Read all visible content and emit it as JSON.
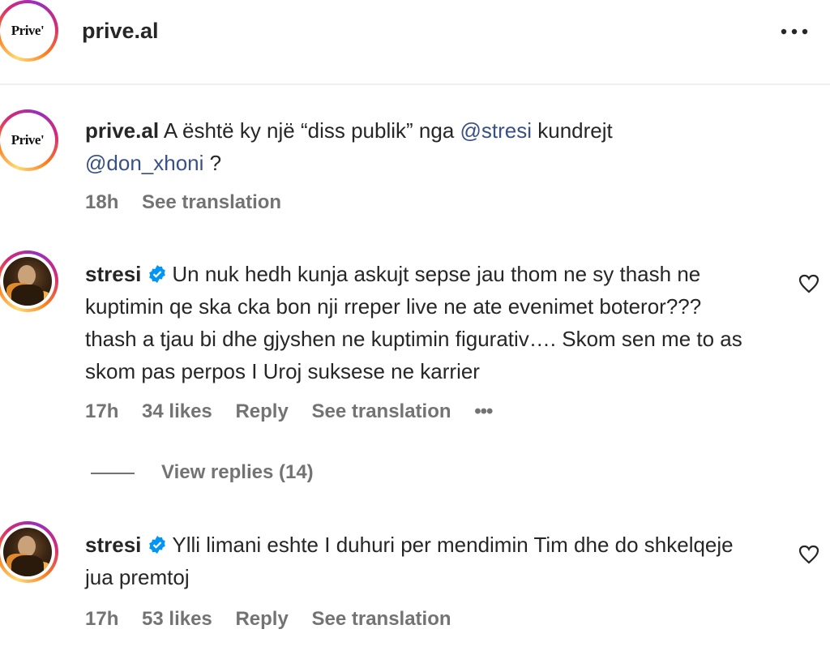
{
  "header": {
    "username": "prive.al",
    "logo_text": "Prive'",
    "more_icon": "more-horizontal-icon"
  },
  "caption": {
    "username": "prive.al",
    "text_before": "A është ky një “diss publik” nga ",
    "mention1": "@stresi",
    "text_mid": " kundrejt",
    "mention2": "@don_xhoni",
    "text_after": " ?",
    "time": "18h",
    "see_translation": "See translation"
  },
  "comments": [
    {
      "username": "stresi",
      "text": "Un nuk hedh kunja askujt sepse jau thom ne sy thash ne kuptimin qe ska cka bon nji rreper live ne ate evenimet boteror??? thash a tjau bi dhe gjyshen ne kuptimin figurativ…. Skom sen me to as skom pas perpos I Uroj suksese ne karrier",
      "time": "17h",
      "likes": "34 likes",
      "reply": "Reply",
      "see_translation": "See translation",
      "more": "•••",
      "view_replies": "View replies (14)"
    },
    {
      "username": "stresi",
      "text": "Ylli limani eshte I duhuri per mendimin Tim dhe do shkelqeje jua premtoj",
      "time": "17h",
      "likes": "53 likes",
      "reply": "Reply",
      "see_translation": "See translation"
    }
  ],
  "colors": {
    "mention": "#385185",
    "meta": "#737373",
    "verified": "#0095f6"
  }
}
